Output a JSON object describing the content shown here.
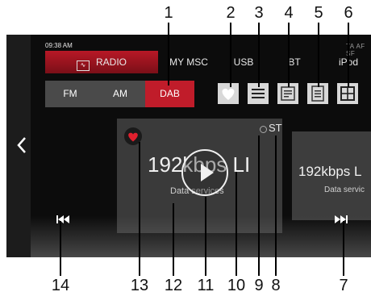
{
  "callouts": {
    "top": [
      "1",
      "2",
      "3",
      "4",
      "5",
      "6"
    ],
    "bottom": [
      "14",
      "13",
      "12",
      "11",
      "10",
      "9",
      "8",
      "7"
    ]
  },
  "status": {
    "clock": "09:38 AM",
    "indicators": "TA  AF  SF"
  },
  "tabs": [
    {
      "label": "RADIO",
      "icon": "radio-wave-icon",
      "active": true
    },
    {
      "label": "MY MSC"
    },
    {
      "label": "USB"
    },
    {
      "label": "BT"
    },
    {
      "label": "iPod"
    }
  ],
  "bands": [
    {
      "label": "FM"
    },
    {
      "label": "AM"
    },
    {
      "label": "DAB",
      "active": true
    }
  ],
  "toolbar_icons": [
    "favorite-heart-icon",
    "list-menu-icon",
    "text-info-icon",
    "document-icon",
    "grid-view-icon"
  ],
  "now_playing": {
    "station": "192kbps LI",
    "service": "Data services",
    "stereo": "ST",
    "favorite": true
  },
  "next_card": {
    "station": "192kbps L",
    "service": "Data servic"
  },
  "colors": {
    "accent": "#c01c2a",
    "background": "#0c0c0c",
    "card": "#3a3a3a",
    "icon_button": "#d8d8d8"
  }
}
